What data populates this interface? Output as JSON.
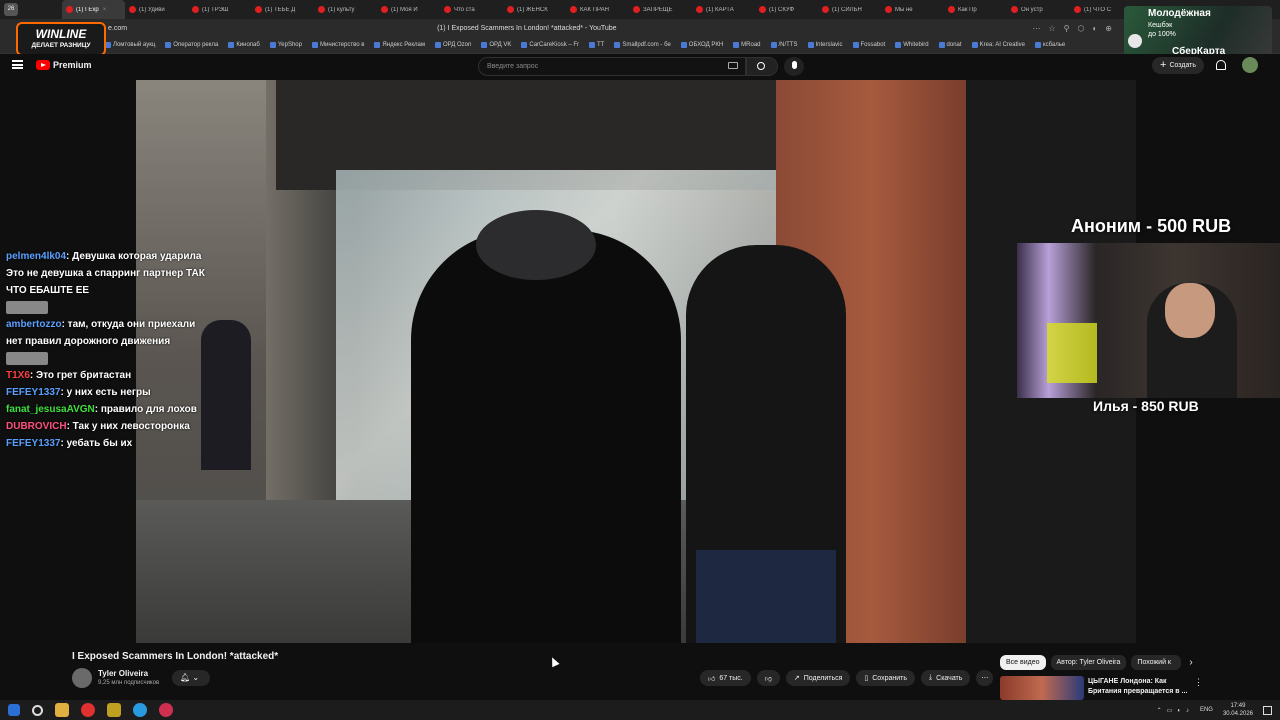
{
  "browser": {
    "tab_count": "26",
    "tabs": [
      "(1) I Exp",
      "(1) Удиви",
      "(1) ТРЭШ",
      "(1) ТЕБЕ Д",
      "(1) культу",
      "(1) Моя И",
      "Что ста",
      "(1) ЖЕНСК",
      "КАК ПРАН",
      "ЗАПРЕЩЕ",
      "(1) КАРТА",
      "(1) СКУФ",
      "(1) СИЛЬН",
      "Мы не",
      "Как Пр",
      "Он устр",
      "(1) ЧТО С"
    ],
    "page_title": "(1) I Exposed Scammers In London! *attacked* - YouTube",
    "url_fragment": "e.com",
    "bookmarks": [
      "Ломтовый аукц",
      "Оператор рекла",
      "Кинопаб",
      "YepShop",
      "Министерство в",
      "Яндекс Реклам",
      "ОРД Ozon",
      "ОРД VK",
      "CarCareKiosk – Fr",
      "TT",
      "Smallpdf.com - бе",
      "ОБХОД РКН",
      "MRoad",
      "/N/TTS",
      "Interslavic",
      "Fossabot",
      "Whitebird",
      "donat",
      "Krea: AI Creative",
      "ксбалье"
    ]
  },
  "ad": {
    "brand": "WINLINE",
    "slogan": "ДЕЛАЕТ РАЗНИЦУ",
    "sber_line1": "Молодёжная",
    "sber_line2": "Кешбэк",
    "sber_line3": "до 100%",
    "sber_line4": "СберКарта"
  },
  "youtube": {
    "logo_label": "Premium",
    "search_placeholder": "Введите запрос",
    "create_label": "Создать",
    "video_title": "I Exposed Scammers In London! *attacked*",
    "channel_name": "Tyler Oliveira",
    "subscribers": "9,25 млн подписчиков",
    "likes": "67 тыс.",
    "share": "Поделиться",
    "save": "Сохранить",
    "download": "Скачать",
    "filters": [
      "Все видео",
      "Автор: Tyler Oliveira",
      "Похожий к"
    ],
    "rec_title_line1": "ЦЫГАНЕ Лондона: Как",
    "rec_title_line2": "Британия превращается в ..."
  },
  "stream": {
    "donation_top": "Аноним - 500 RUB",
    "donation_bottom": "Илья - 850 RUB",
    "chat": [
      {
        "user": "pelmen4lk04",
        "text": "Девушка которая ударила Это не девушка а спарринг партнер ТАК ЧТО ЕБАШТЕ ЕЕ",
        "color": "#5aa0ff"
      },
      {
        "user": "ambertozzo",
        "text": "там, откуда они приехали нет правил дорожного движения",
        "color": "#5aa0ff"
      },
      {
        "user": "T1X6",
        "text": "Это грет бритастан",
        "color": "#ff4040"
      },
      {
        "user": "FEFEY1337",
        "text": "у них есть негры",
        "color": "#5aa0ff"
      },
      {
        "user": "fanat_jesusaAVGN",
        "text": "правило для лохов",
        "color": "#40e040"
      },
      {
        "user": "DUBROVICH",
        "text": "Так у них левосторонка",
        "color": "#ff5080"
      },
      {
        "user": "FEFEY1337",
        "text": "уебать бы их",
        "color": "#5aa0ff"
      }
    ]
  },
  "taskbar": {
    "lang": "ENG",
    "time": "17:49",
    "date": "30.04.2026"
  }
}
